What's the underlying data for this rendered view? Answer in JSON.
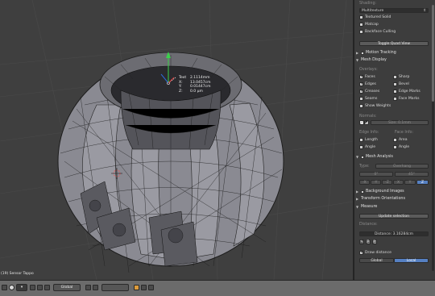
{
  "viewport": {
    "object_info": "(19) Sensor Tappo",
    "measure": {
      "rows": [
        {
          "label": "Text",
          "value": "2.1114mm"
        },
        {
          "label": "X:",
          "value": "13.0457cm"
        },
        {
          "label": "Y:",
          "value": "0.01447cm"
        },
        {
          "label": "Z:",
          "value": "0.0 µm"
        }
      ]
    }
  },
  "panel": {
    "shading_label": "Shading:",
    "shading_value": "Multitexture",
    "textured_solid": "Textured Solid",
    "matcap": "Matcap",
    "backface_culling": "Backface Culling",
    "toggle_quad_view": "Toggle Quad View",
    "motion_tracking": "Motion Tracking",
    "mesh_display": "Mesh Display",
    "overlays_label": "Overlays:",
    "overlays": [
      {
        "left": "Faces",
        "left_on": true,
        "right": "Sharp",
        "right_on": false
      },
      {
        "left": "Edges",
        "left_on": true,
        "right": "Bevel",
        "right_on": false
      },
      {
        "left": "Creases",
        "left_on": true,
        "right": "Edge Marks",
        "right_on": false
      },
      {
        "left": "Seams",
        "left_on": false,
        "right": "Face Marks",
        "right_on": false
      }
    ],
    "show_weights": "Show Weights",
    "normals_label": "Normals:",
    "normals_size": "Size: 0.1mm",
    "edge_info": "Edge Info:",
    "face_info": "Face Info:",
    "info_rows": [
      {
        "left": "Length",
        "right": "Area"
      },
      {
        "left": "Angle",
        "right": "Angle"
      }
    ],
    "mesh_analysis": "Mesh Analysis",
    "analysis_type_label": "Type:",
    "analysis_type": "Overhang",
    "analysis_min": "0°",
    "analysis_max": "45°",
    "axis_buttons": [
      "-X",
      "-Y",
      "-Z",
      "X",
      "Y",
      "Z"
    ],
    "background_images": "Background Images",
    "transform_orientations": "Transform Orientations",
    "measure": "Measure",
    "update_selection": "Update selection",
    "distance_label": "Distance:",
    "distance_value": "Distance: 3.16284cm",
    "draw_distance": "Draw distance",
    "global": "Global",
    "local": "Local"
  },
  "bottombar": {
    "mode": "Object Mode",
    "pivot": "Global"
  }
}
